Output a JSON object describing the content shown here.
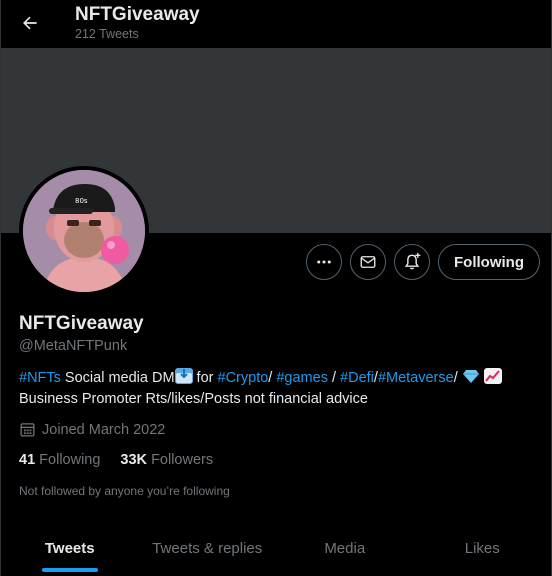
{
  "header": {
    "title": "NFTGiveaway",
    "subtitle": "212 Tweets",
    "back_icon": "arrow-left-icon"
  },
  "colors": {
    "background": "#000000",
    "banner": "#333639",
    "accent": "#1d9bf0",
    "muted": "#71767b",
    "text": "#e7e9ea"
  },
  "actions": {
    "more_icon": "more-icon",
    "message_icon": "mail-icon",
    "notify_icon": "bell-plus-icon",
    "follow_label": "Following"
  },
  "profile": {
    "name": "NFTGiveaway",
    "handle": "@MetaNFTPunk",
    "bio": {
      "tag_nfts": "#NFTs",
      "text1": " Social media DM",
      "text2": " for ",
      "tag_crypto": "#Crypto",
      "text3": "/ ",
      "tag_games": "#games",
      "text4": " / ",
      "tag_defi": "#Defi",
      "text5": "/",
      "tag_metaverse": "#Metaverse",
      "text6": "/ ",
      "line2": "Business Promoter Rts/likes/Posts not financial advice"
    },
    "joined": "Joined March 2022",
    "following_count": "41",
    "following_label": "Following",
    "followers_count": "33K",
    "followers_label": "Followers",
    "not_followed": "Not followed by anyone you’re following"
  },
  "tabs": [
    {
      "label": "Tweets",
      "active": true
    },
    {
      "label": "Tweets & replies",
      "active": false
    },
    {
      "label": "Media",
      "active": false
    },
    {
      "label": "Likes",
      "active": false
    }
  ]
}
